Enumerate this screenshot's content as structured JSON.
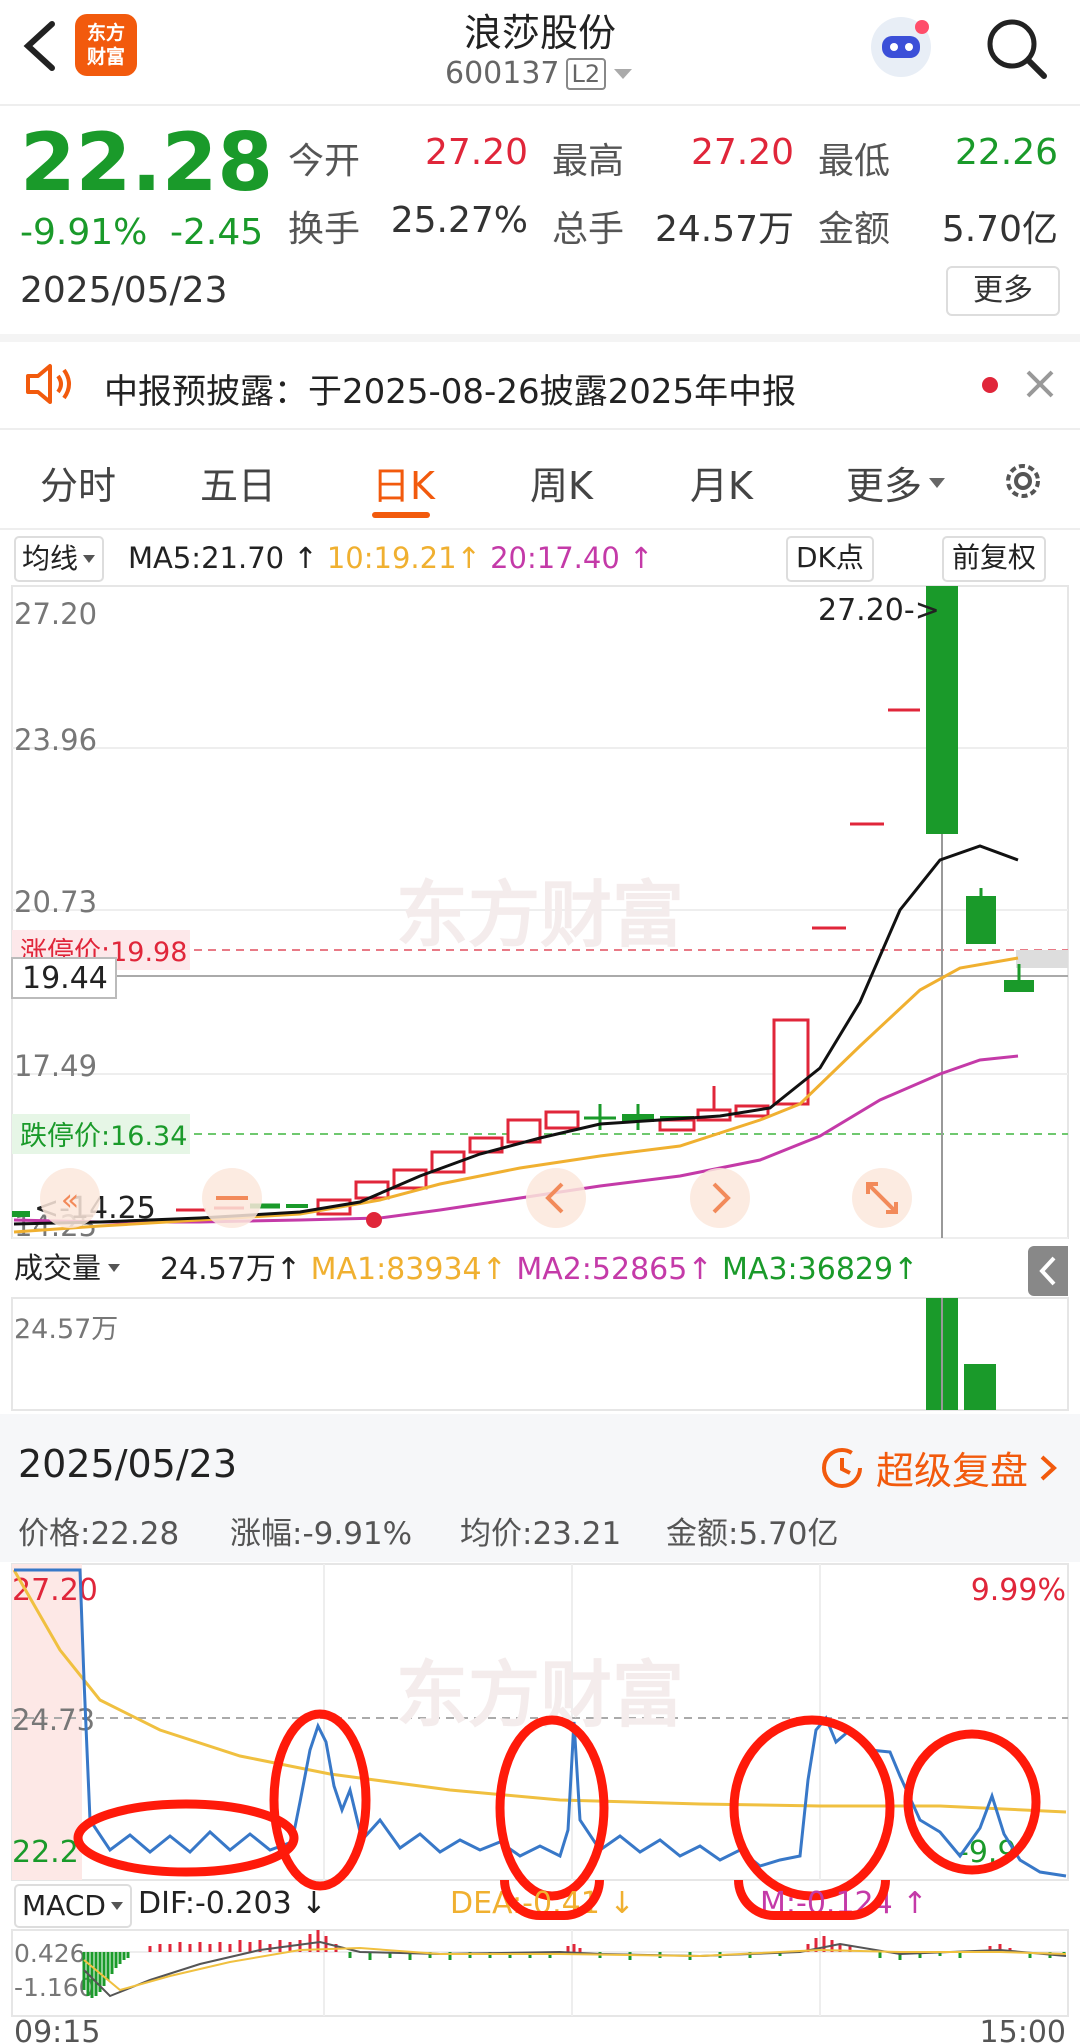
{
  "header": {
    "back_icon": "chevron-left-icon",
    "logo_text": "东方财富",
    "stock_name": "浪莎股份",
    "stock_code": "600137",
    "level_badge": "L2",
    "robot_icon": "robot-avatar-icon",
    "search_icon": "search-icon"
  },
  "quote": {
    "price": "22.28",
    "change_pct": "-9.91%",
    "change_amt": "-2.45",
    "date": "2025/05/23",
    "open_label": "今开",
    "open_value": "27.20",
    "high_label": "最高",
    "high_value": "27.20",
    "low_label": "最低",
    "low_value": "22.26",
    "turnover_label": "换手",
    "turnover_value": "25.27%",
    "volume_label": "总手",
    "volume_value": "24.57万",
    "amount_label": "金额",
    "amount_value": "5.70亿",
    "more_label": "更多"
  },
  "notice": {
    "speaker_icon": "speaker-icon",
    "text": "中报预披露：于2025-08-26披露2025年中报",
    "close_icon": "close-icon"
  },
  "tabs": [
    {
      "label": "分时"
    },
    {
      "label": "五日"
    },
    {
      "label": "日K"
    },
    {
      "label": "周K"
    },
    {
      "label": "月K"
    },
    {
      "label": "更多"
    }
  ],
  "active_tab": "日K",
  "settings_icon": "gear-icon",
  "ma_bar": {
    "selector": "均线",
    "ma5": "MA5:21.70",
    "ma10": "10:19.21",
    "ma20": "20:17.40",
    "dk_label": "DK点",
    "adjust_label": "前复权"
  },
  "kline": {
    "y_labels": [
      "27.20",
      "23.96",
      "20.73",
      "17.49"
    ],
    "limit_up_label": "涨停价:19.98",
    "limit_down_label": "跌停价:16.34",
    "cursor_price": "19.44",
    "high_marker": "27.20->",
    "low_marker": "<-14.25",
    "low_axis": "14.25",
    "watermark": "东方财富"
  },
  "volume_bar": {
    "selector": "成交量",
    "value": "24.57万",
    "ma1": "MA1:83934",
    "ma2": "MA2:52865",
    "ma3": "MA3:36829",
    "axis_label": "24.57万"
  },
  "intraday_info": {
    "date": "2025/05/23",
    "replay_label": "超级复盘",
    "price_text": "价格:22.28",
    "change_text": "涨幅:-9.91%",
    "avg_text": "均价:23.21",
    "amount_text": "金额:5.70亿"
  },
  "intraday_chart": {
    "top_left": "27.20",
    "top_right": "9.99%",
    "mid_left": "24.73",
    "bottom_left": "22.2",
    "bottom_right": "-9.9",
    "watermark": "东方财富"
  },
  "macd": {
    "selector": "MACD",
    "dif": "DIF:-0.203",
    "dea": "DEA:-0.41",
    "m": "M:-0.124",
    "axis_top": "0.426",
    "axis_bottom": "-1.160",
    "time_start": "09:15",
    "time_end": "15:00"
  },
  "colors": {
    "up": "#e0263a",
    "down": "#1a9a2a",
    "accent": "#f25a0d",
    "ma5": "#111111",
    "ma10": "#f0b030",
    "ma20": "#c43aa8",
    "price_line": "#3878c8",
    "avg_line": "#f0c040",
    "annotation": "#ff1a0a"
  }
}
